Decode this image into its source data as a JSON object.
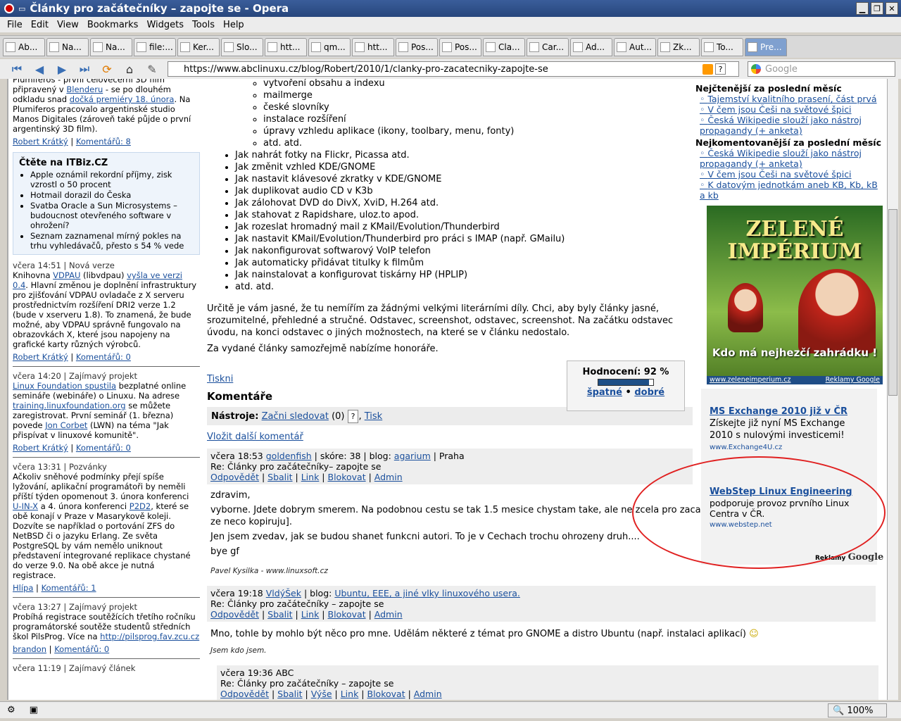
{
  "window": {
    "title": "Články pro začátečníky – zapojte se - Opera"
  },
  "menu": [
    "File",
    "Edit",
    "View",
    "Bookmarks",
    "Widgets",
    "Tools",
    "Help"
  ],
  "tabs": [
    "Ab...",
    "Na...",
    "Na...",
    "file:...",
    "Ker...",
    "Slo...",
    "htt...",
    "qm...",
    "htt...",
    "Pos...",
    "Pos...",
    "Cla...",
    "Car...",
    "Ad...",
    "Aut...",
    "Zk...",
    "To...",
    "Pre..."
  ],
  "address": {
    "url": "https://www.abclinuxu.cz/blog/Robert/2010/1/clanky-pro-zacatecniky-zapojte-se",
    "search_placeholder": "Google"
  },
  "status": {
    "zoom": "100%"
  },
  "left": {
    "top_text": "Plumiferos - první celovečerní 3D film připravený v",
    "blender": "Blenderu",
    "top_text2": "- se po dlouhém odkladu snad",
    "premiere": "dočká premiéry 18. února",
    "top_text3": ". Na Plumiferos pracovalo argentinské studio Manos Digitales (zároveň také půjde o první argentinský 3D film).",
    "author1": "Robert Krátký",
    "comments1": "Komentářů: 8",
    "itbiz_prefix": "Čtěte na",
    "itbiz_brand": "ITBiz",
    "itbiz_suffix": ".CZ",
    "itbiz_items": [
      "Apple oznámil rekordní příjmy, zisk vzrostl o 50 procent",
      "Hotmail dorazil do Česka",
      "Svatba Oracle a Sun Microsystems – budoucnost otevřeného software v ohrožení?",
      "Seznam zaznamenal mírný pokles na trhu vyhledávačů, přesto s 54 % vede"
    ],
    "n1_head": "včera 14:51 | Nová verze",
    "n1_a": "Knihovna",
    "n1_link1": "VDPAU",
    "n1_b": "(libvdpau)",
    "n1_link2": "vyšla ve verzi 0.4",
    "n1_c": ". Hlavní změnou je doplnění infrastruktury pro zjišťování VDPAU ovladače z X serveru prostřednictvím rozšíření DRI2 verze 1.2 (bude v xserveru 1.8). To znamená, že bude možné, aby VDPAU správně fungovalo na obrazovkách X, které jsou napojeny na grafické karty různých výrobců.",
    "n1_author": "Robert Krátký",
    "n1_comments": "Komentářů: 0",
    "n2_head": "včera 14:20 | Zajímavý projekt",
    "n2_link1": "Linux Foundation spustila",
    "n2_a": "bezplatné online semináře (webináře) o Linuxu. Na adrese",
    "n2_link2": "training.linuxfoundation.org",
    "n2_b": "se můžete zaregistrovat. První seminář (1. března) povede",
    "n2_link3": "Jon Corbet",
    "n2_c": "(LWN) na téma \"Jak přispívat v linuxové komunitě\".",
    "n2_author": "Robert Krátký",
    "n2_comments": "Komentářů: 0",
    "n3_head": "včera 13:31 | Pozvánky",
    "n3_a": "Ačkoliv sněhové podmínky přejí spíše lyžování, aplikační programátoři by neměli příští týden opomenout 3. února konferenci",
    "n3_link1": "U-IN-X",
    "n3_b": "a 4. února konferenci",
    "n3_link2": "P2D2",
    "n3_c": ", které se obě konají v Praze v Masarykově koleji. Dozvíte se například o portování ZFS do NetBSD či o jazyku Erlang. Ze světa PostgreSQL by vám nemělo uniknout představení integrované replikace chystané do verze 9.0. Na obě akce je nutná registrace.",
    "n3_author": "Hlípa",
    "n3_comments": "Komentářů: 1",
    "n4_head": "včera 13:27 | Zajímavý projekt",
    "n4_a": "Probíhá registrace soutěžících třetího ročníku programátorské soutěže studentů středních škol PilsProg. Více na",
    "n4_link": "http://pilsprog.fav.zcu.cz",
    "n4_author": "brandon",
    "n4_comments": "Komentářů: 0",
    "n5_head": "včera 11:19 | Zajímavý článek"
  },
  "center": {
    "sub_items": [
      "vytvoření obsahu a indexu",
      "mailmerge",
      "české slovníky",
      "instalace rozšíření",
      "úpravy vzhledu aplikace (ikony, toolbary, menu, fonty)",
      "atd. atd."
    ],
    "items": [
      "Jak nahrát fotky na Flickr, Picassa atd.",
      "Jak změnit vzhled KDE/GNOME",
      "Jak nastavit klávesové zkratky v KDE/GNOME",
      "Jak duplikovat audio CD v K3b",
      "Jak zálohovat DVD do DivX, XviD, H.264 atd.",
      "Jak stahovat z Rapidshare, uloz.to apod.",
      "Jak rozeslat hromadný mail z KMail/Evolution/Thunderbird",
      "Jak nastavit KMail/Evolution/Thunderbird pro práci s IMAP (např. GMailu)",
      "Jak nakonfigurovat softwarový VoIP telefon",
      "Jak automaticky přidávat titulky k filmům",
      "Jak nainstalovat a konfigurovat tiskárny HP (HPLIP)",
      "atd. atd."
    ],
    "para1": "Určitě je vám jasné, že tu nemířím za žádnými velkými literárními díly. Chci, aby byly články jasné, srozumitelné, přehledné a stručné. Odstavec, screenshot, odstavec, screenshot. Na začátku odstavec úvodu, na konci odstavec o jiných možnostech, na které se v článku nedostalo.",
    "para2": "Za vydané články samozřejmě nabízíme honoráře.",
    "print": "Tiskni",
    "rating_label": "Hodnocení: 92 %",
    "rating_value": 0.92,
    "rating_bad": "špatné",
    "rating_good": "dobré",
    "comments_heading": "Komentáře",
    "tools_label": "Nástroje:",
    "tools_follow": "Začni sledovat",
    "tools_count": "(0)",
    "tools_q": "?",
    "tools_print": "Tisk",
    "add_comment": "Vložit další komentář",
    "c1": {
      "time": "včera 18:53",
      "user": "goldenfish",
      "score": "| skóre: 38 | blog:",
      "blog": "agarium",
      "place": "| Praha",
      "subject": "Re: Články pro začátečníky– zapojte se",
      "lines": [
        "zdravim,",
        "vyborne. Jdete dobrym smerem. Na podobnou cestu se tak 1.5 mesice chystam take, ale ne zcela pro zacatecniky, kdyby nekdo casem namital, ze neco kopiruju].",
        "Jen jsem zvedav, jak se budou shanet funkcni autori. To je v Cechach trochu ohrozeny druh....",
        "bye gf"
      ],
      "sig": "Pavel Kysilka - www.linuxsoft.cz"
    },
    "c2": {
      "time": "včera 19:18",
      "user": "VldýŠek",
      "blogpre": "| blog:",
      "blog": "Ubuntu, EEE, a jiné vlky linuxového usera.",
      "subject": "Re: Články pro začátečníky – zapojte se",
      "text": "Mno, tohle by mohlo být něco pro mne. Udělám některé z témat pro GNOME a distro Ubuntu (např. instalaci aplikací)",
      "sig": "Jsem kdo jsem."
    },
    "c3": {
      "time": "včera 19:36 ABC",
      "subject": "Re: Články pro začátečníky – zapojte se"
    },
    "actions": [
      "Odpovědět",
      "Sbalit",
      "Link",
      "Blokovat",
      "Admin"
    ],
    "actions3": [
      "Odpovědět",
      "Sbalit",
      "Výše",
      "Link",
      "Blokovat",
      "Admin"
    ]
  },
  "right": {
    "h1": "Nejčtenější za poslední měsíc",
    "list1": [
      "Tajemství kvalitního prasení, část prvá",
      "V čem jsou Češi na světové špici",
      "Česká Wikipedie slouží jako nástroj propagandy (+ anketa)"
    ],
    "h2": "Nejkomentovanější za poslední měsíc",
    "list2": [
      "Česká Wikipedie slouží jako nástroj propagandy (+ anketa)",
      "V čem jsou Češi na světové špici",
      "K datovým jednotkám aneb KB, Kb, kB a kb"
    ],
    "banner_title": "ZELENÉ IMPÉRIUM",
    "banner_tag": "Kdo má nejhezčí zahrádku !",
    "banner_url": "www.zeleneimperium.cz",
    "banner_ads": "Reklamy Google",
    "ad1_title": "MS Exchange 2010 již v ČR",
    "ad1_text": "Získejte již nyní MS Exchange 2010 s nulovými investicemi!",
    "ad1_url": "www.Exchange4U.cz",
    "ad2_title": "WebStep Linux Engineering",
    "ad2_text": "podporuje provoz prvního Linux Centra v ČR.",
    "ad2_url": "www.webstep.net",
    "reklamy": "Reklamy",
    "google": "Google"
  }
}
